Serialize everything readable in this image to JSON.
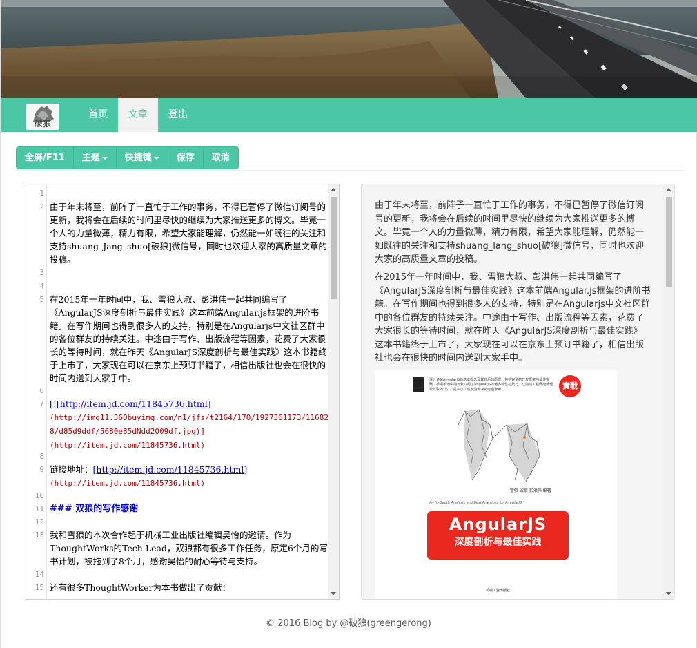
{
  "navbar": {
    "logo_text": "破狼",
    "items": [
      {
        "label": "首页"
      },
      {
        "label": "文章"
      },
      {
        "label": "登出"
      }
    ]
  },
  "toolbar": {
    "fullscreen": "全屏/F11",
    "theme": "主题",
    "shortcuts": "快捷键",
    "save": "保存",
    "cancel": "取消"
  },
  "editor": {
    "line_numbers": [
      "1",
      "2",
      "3",
      "4",
      "5",
      "6",
      "7",
      "8",
      "9",
      "10",
      "11",
      "12",
      "13",
      "14",
      "15"
    ],
    "line2": "由于年末将至，前阵子一直忙于工作的事务，不得已暂停了微信订阅号的更新，我将会在后续的时间里尽快的继续为大家推送更多的博文。毕竟一个人的力量微薄，精力有限，希望大家能理解，仍然能一如既往的关注和支持shuang_Jang_shuo[破狼]微信号，同时也欢迎大家的高质量文章的投稿。",
    "line5": "在2015年一年时间中，我、雪狼大叔、彭洪伟一起共同编写了《AngularJS深度剖析与最佳实践》这本前端Angular.js框架的进阶书籍。在写作期间也得到很多人的支持，特别是在Angularjs中文社区群中的各位群友的持续关注。中途由于写作、出版流程等因素，花费了大家很长的等待时间，就在昨天《AngularJS深度剖析与最佳实践》这本书籍终于上市了，大家现在可以在京东上预订书籍了，相信出版社也会在很快的时间内送到大家手中。",
    "line7_link": "[![http://item.jd.com/11845736.html]",
    "line7_url": "(http://img11.360buyimg.com/n1/jfs/t2164/170/1927361173/116828/d85d9ddf/5680e85dNdd2009df.jpg)]",
    "line7_url2": "(http://item.jd.com/11845736.html)",
    "line9_prefix": "链接地址：",
    "line9_link": "[http://item.jd.com/11845736.html]",
    "line9_url": "(http://item.jd.com/11845736.html)",
    "line11": "### 双狼的写作感谢",
    "line13": "我和雪狼的本次合作起于机械工业出版社编辑吴怡的邀请。作为ThoughtWorks的Tech Lead，双狼都有很多工作任务，原定6个月的写书计划，被拖到了8个月，感谢吴怡的耐心等待与支持。",
    "line15": "还有很多ThoughtWorker为本书做出了贡献："
  },
  "preview": {
    "para1": "由于年末将至，前阵子一直忙于工作的事务，不得已暂停了微信订阅号的更新，我将会在后续的时间里尽快的继续为大家推送更多的博文。毕竟一个人的力量微薄，精力有限，希望大家能理解，仍然能一如既往的关注和支持shuang_lang_shuo[破狼]微信号，同时也欢迎大家的高质量文章的投稿。",
    "para2": "在2015年一年时间中，我、雪狼大叔、彭洪伟一起共同编写了《AngularJS深度剖析与最佳实践》这本前端Angular.js框架的进阶书籍。在写作期间也得到很多人的支持，特别是在Angularjs中文社区群中的各位群友的持续关注。中途由于写作、出版流程等因素，花费了大家很长的等待时间，就在昨天《AngularJS深度剖析与最佳实践》这本书籍终于上市了，大家现在可以在京东上预订书籍了，相信出版社也会在很快的时间内送到大家手中。",
    "book": {
      "title": "AngularJS",
      "subtitle": "深度剖析与最佳实践",
      "badge": "實戰",
      "authors": "雪狼 破狼 彭洪伟 编著",
      "top_blurb": "深入讲解AngularJS的基本概念及其背后的原理，包括完整的开发框架与最佳实践。手把手地由简到繁介绍了AngularJS的诸多特性与技巧，让前端工程师能够轻松驾驭的\"坑\"，是从小工成长为专家的必备参考。",
      "english": "An In-Depth Analysis and Best Practices for AngularJS",
      "publisher": "机械工业出版社"
    }
  },
  "footer": {
    "text": "© 2016 Blog by @破狼(greengerong)"
  },
  "colors": {
    "accent": "#4cc7a6",
    "accent_border": "#3fb896",
    "book_red": "#e8271f",
    "md_link": "#0000cc",
    "md_url": "#aa0000"
  }
}
